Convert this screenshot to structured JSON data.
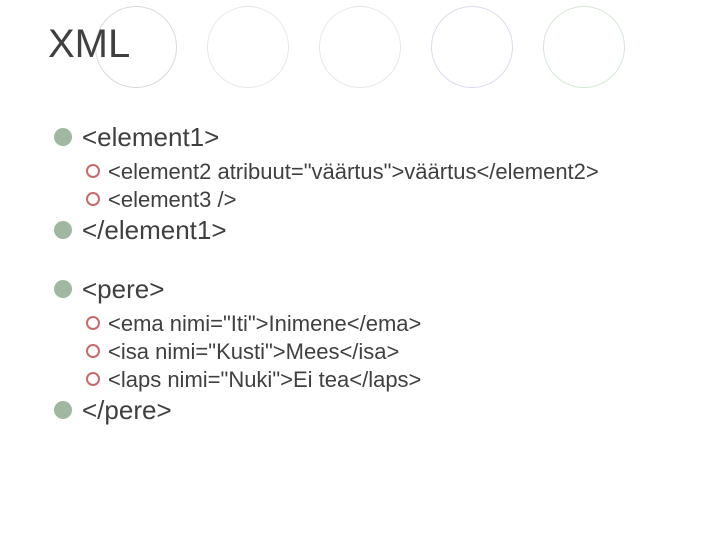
{
  "title": "XML",
  "block1": {
    "open": "<element1>",
    "children": [
      "<element2 atribuut=\"väärtus\">väärtus</element2>",
      "<element3 />"
    ],
    "close": "</element1>"
  },
  "block2": {
    "open": "<pere>",
    "children": [
      "<ema nimi=\"Iti\">Inimene</ema>",
      "<isa nimi=\"Kusti\">Mees</isa>",
      "<laps nimi=\"Nuki\">Ei tea</laps>"
    ],
    "close": "</pere>"
  }
}
